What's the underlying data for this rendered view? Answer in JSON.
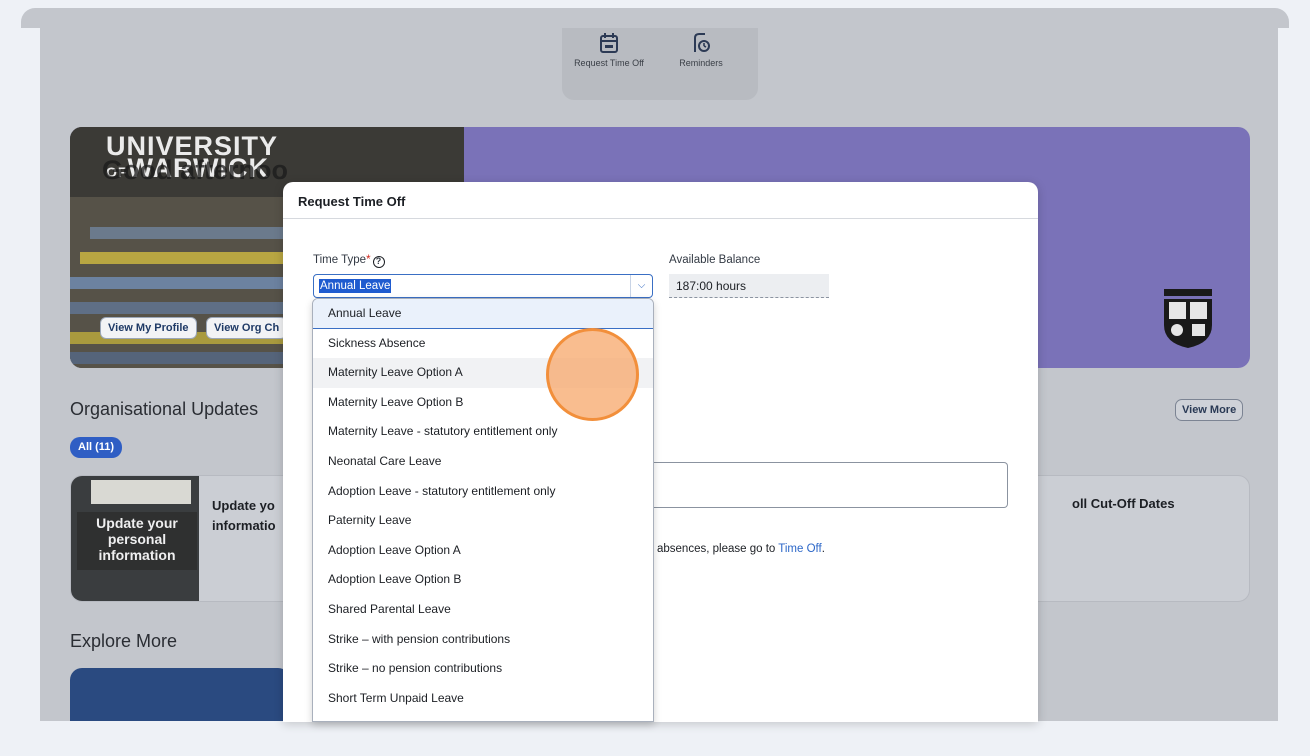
{
  "quick_actions": [
    {
      "label": "Request Time Off",
      "icon": "calendar-icon"
    },
    {
      "label": "Reminders",
      "icon": "reminder-icon"
    }
  ],
  "hero": {
    "logo_line1": "UNIVERSITY",
    "logo_of": "OF",
    "logo_line2": "WARWICK",
    "greeting": "Good afternoo",
    "buttons": [
      "View My Profile",
      "View Org Ch"
    ]
  },
  "updates": {
    "title": "Organisational Updates",
    "filter_all": "All (11)",
    "view_more": "View More",
    "card_thumb_text": "Update your personal information",
    "card_title_line1": "Update yo",
    "card_title_line2": "informatio",
    "payroll_title": "oll Cut-Off Dates"
  },
  "explore": {
    "title": "Explore More"
  },
  "dialog": {
    "title": "Request Time Off",
    "time_type_label": "Time Type",
    "required_mark": "*",
    "time_type_value": "Annual Leave",
    "balance_label": "Available Balance",
    "balance_value": "187:00 hours",
    "note_text": "absences, please go to ",
    "note_link": "Time Off",
    "note_end": "."
  },
  "dropdown": {
    "options": [
      "Annual Leave",
      "Sickness Absence",
      "Maternity Leave Option A",
      "Maternity Leave Option B",
      "Maternity Leave - statutory entitlement only",
      "Neonatal Care Leave",
      "Adoption Leave - statutory entitlement only",
      "Paternity Leave",
      "Adoption Leave Option A",
      "Adoption Leave Option B",
      "Shared Parental Leave",
      "Strike – with pension contributions",
      "Strike – no pension contributions",
      "Short Term Unpaid Leave"
    ],
    "selected_index": 0,
    "hover_index": 2
  },
  "colors": {
    "accent": "#2f5ec4",
    "hero_purple": "#7a72b8",
    "cursor_highlight": "#f28f3b"
  }
}
